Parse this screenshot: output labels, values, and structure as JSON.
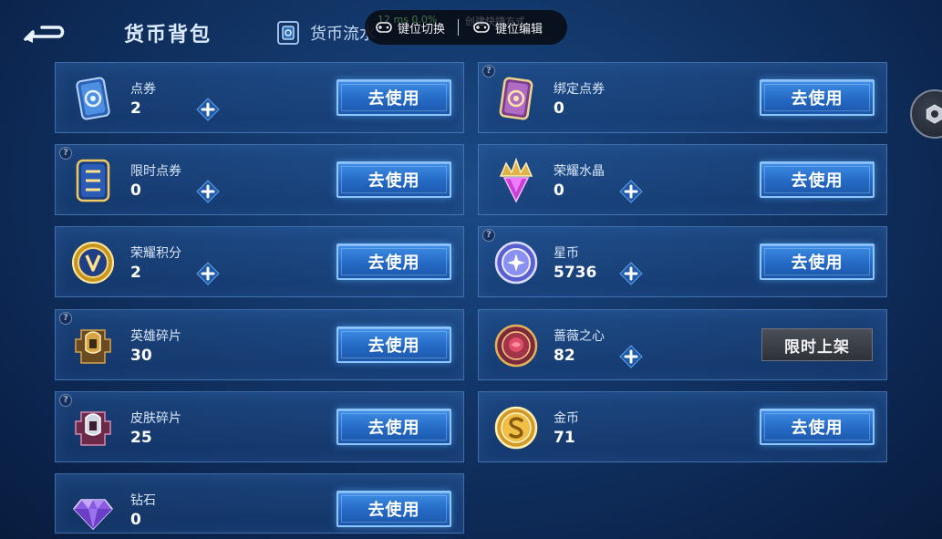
{
  "header": {
    "title": "货币背包",
    "tab_flow": "货币流水"
  },
  "overlay": {
    "switch_label": "键位切换",
    "edit_label": "键位编辑",
    "ghost_left": "12 ms  0.0%",
    "ghost_right": "创建快捷方式"
  },
  "buttons": {
    "use": "去使用",
    "limited": "限时上架"
  },
  "items": [
    {
      "name": "点券",
      "count": "2"
    },
    {
      "name": "绑定点券",
      "count": "0"
    },
    {
      "name": "限时点券",
      "count": "0"
    },
    {
      "name": "荣耀水晶",
      "count": "0"
    },
    {
      "name": "荣耀积分",
      "count": "2"
    },
    {
      "name": "星币",
      "count": "5736"
    },
    {
      "name": "英雄碎片",
      "count": "30"
    },
    {
      "name": "蔷薇之心",
      "count": "82"
    },
    {
      "name": "皮肤碎片",
      "count": "25"
    },
    {
      "name": "金币",
      "count": "71"
    },
    {
      "name": "钻石",
      "count": "0"
    }
  ],
  "icons": {
    "back": "back-arrow-icon",
    "flow": "ledger-icon",
    "gear": "gear-icon",
    "plus": "plus-icon",
    "help": "question-icon"
  },
  "colors": {
    "button": "#2a74d0",
    "button_border": "#8cc6ff",
    "background": "#123668",
    "limited_tag": "#3a3f46"
  }
}
